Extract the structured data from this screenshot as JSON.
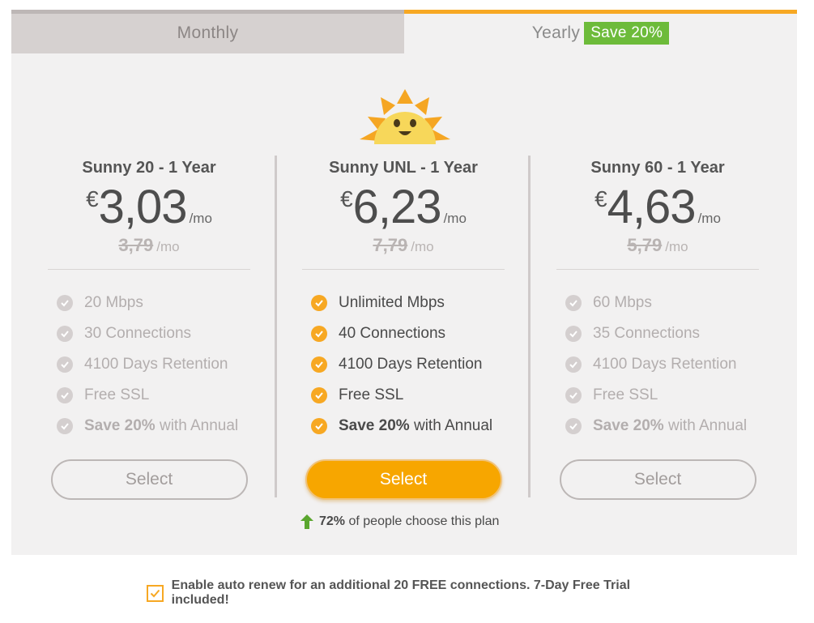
{
  "tabs": {
    "monthly": "Monthly",
    "yearly": "Yearly",
    "yearly_badge": "Save 20%"
  },
  "colors": {
    "accent": "#f7a823",
    "badge": "#6dbb3a",
    "panel": "#f2f1f1"
  },
  "plans": [
    {
      "title": "Sunny 20 - 1 Year",
      "currency": "€",
      "price": "3,03",
      "per": "/mo",
      "old_price": "3,79",
      "old_per": "/mo",
      "features": [
        "20 Mbps",
        "30 Connections",
        "4100 Days Retention",
        "Free SSL"
      ],
      "save_bold": "Save 20%",
      "save_rest": " with Annual",
      "select_label": "Select"
    },
    {
      "title": "Sunny UNL - 1 Year",
      "currency": "€",
      "price": "6,23",
      "per": "/mo",
      "old_price": "7,79",
      "old_per": "/mo",
      "features": [
        "Unlimited Mbps",
        "40 Connections",
        "4100 Days Retention",
        "Free SSL"
      ],
      "save_bold": "Save 20%",
      "save_rest": " with Annual",
      "select_label": "Select"
    },
    {
      "title": "Sunny 60 - 1 Year",
      "currency": "€",
      "price": "4,63",
      "per": "/mo",
      "old_price": "5,79",
      "old_per": "/mo",
      "features": [
        "60 Mbps",
        "35 Connections",
        "4100 Days Retention",
        "Free SSL"
      ],
      "save_bold": "Save 20%",
      "save_rest": " with Annual",
      "select_label": "Select"
    }
  ],
  "popular": {
    "percent": "72%",
    "text": "of people choose this plan"
  },
  "autorenew": {
    "checked": true,
    "text": "Enable auto renew for an additional 20 FREE connections. 7-Day Free Trial included!"
  }
}
